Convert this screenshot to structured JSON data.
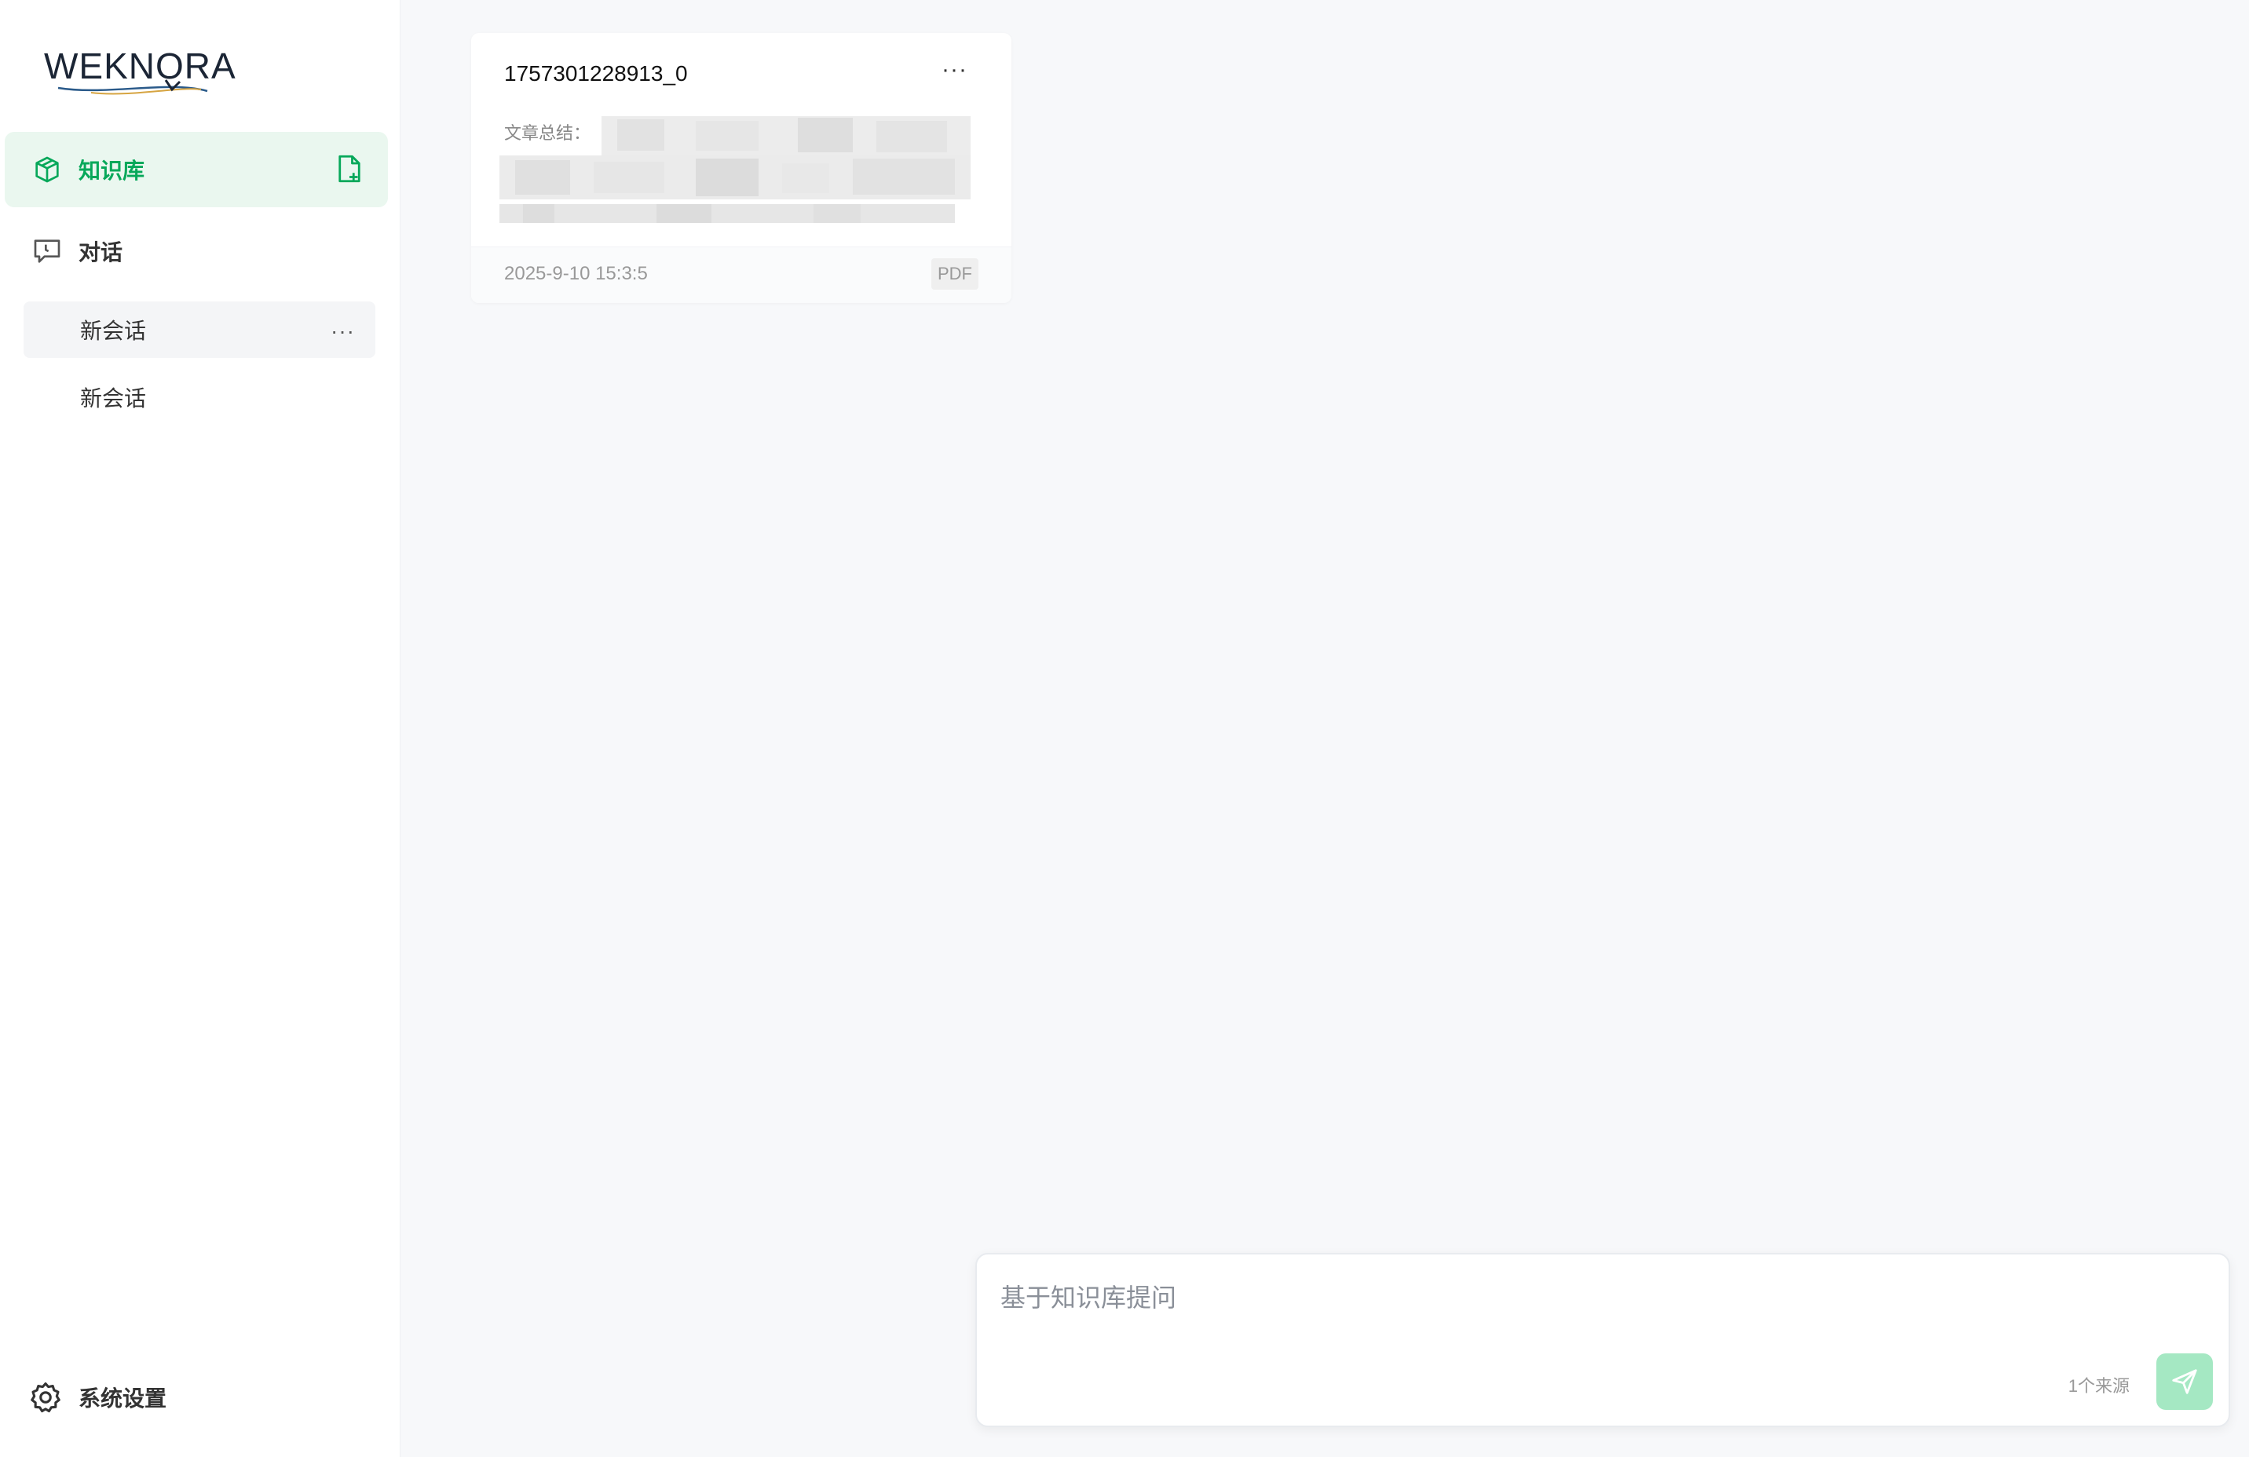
{
  "brand": {
    "logo_text": "WEKNORA",
    "accent_color": "#07a85a"
  },
  "sidebar": {
    "knowledge_base_label": "知识库",
    "chat_label": "对话",
    "sessions": [
      {
        "label": "新会话",
        "active": true
      },
      {
        "label": "新会话",
        "active": false
      }
    ],
    "more_label": "···",
    "settings_label": "系统设置"
  },
  "document_card": {
    "title": "1757301228913_0",
    "summary_label": "文章总结：",
    "date": "2025-9-10 15:3:5",
    "type_badge": "PDF",
    "more_label": "···"
  },
  "chat_input": {
    "placeholder": "基于知识库提问",
    "sources_label": "1个来源"
  }
}
